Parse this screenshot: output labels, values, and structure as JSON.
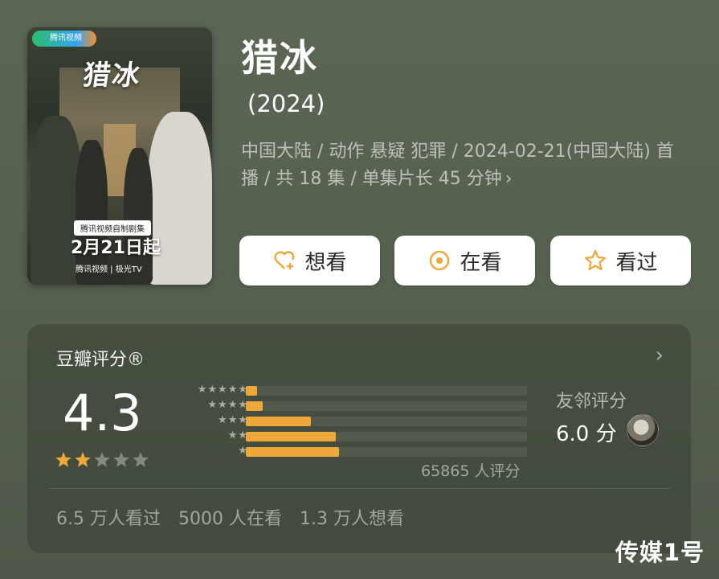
{
  "poster": {
    "platform_badge": "腾讯视频",
    "title_calligraphy": "猎冰",
    "strip_text": "腾讯视频自制剧集",
    "premiere_date": "2月21日起",
    "platforms": "腾讯视频 | 极光TV"
  },
  "header": {
    "title": "猎冰",
    "year": "(2024)",
    "meta": "中国大陆 / 动作 悬疑 犯罪 / 2024-02-21(中国大陆) 首播 / 共 18 集 / 单集片长 45 分钟"
  },
  "actions": {
    "want": "想看",
    "watching": "在看",
    "watched": "看过"
  },
  "rating": {
    "title": "豆瓣评分®",
    "score": "4.3",
    "star_value": 2,
    "star_max": 5,
    "distribution": [
      {
        "stars": 5,
        "fraction": 0.04
      },
      {
        "stars": 4,
        "fraction": 0.06
      },
      {
        "stars": 3,
        "fraction": 0.23
      },
      {
        "stars": 2,
        "fraction": 0.32
      },
      {
        "stars": 1,
        "fraction": 0.33
      }
    ],
    "count_text": "65865 人评分",
    "friend_label": "友邻评分",
    "friend_score": "6.0 分",
    "stats": [
      "6.5 万人看过",
      "5000 人在看",
      "1.3 万人想看"
    ]
  },
  "colors": {
    "accent": "#f0a73a",
    "background": "#58634f"
  },
  "watermark": "传媒1号"
}
